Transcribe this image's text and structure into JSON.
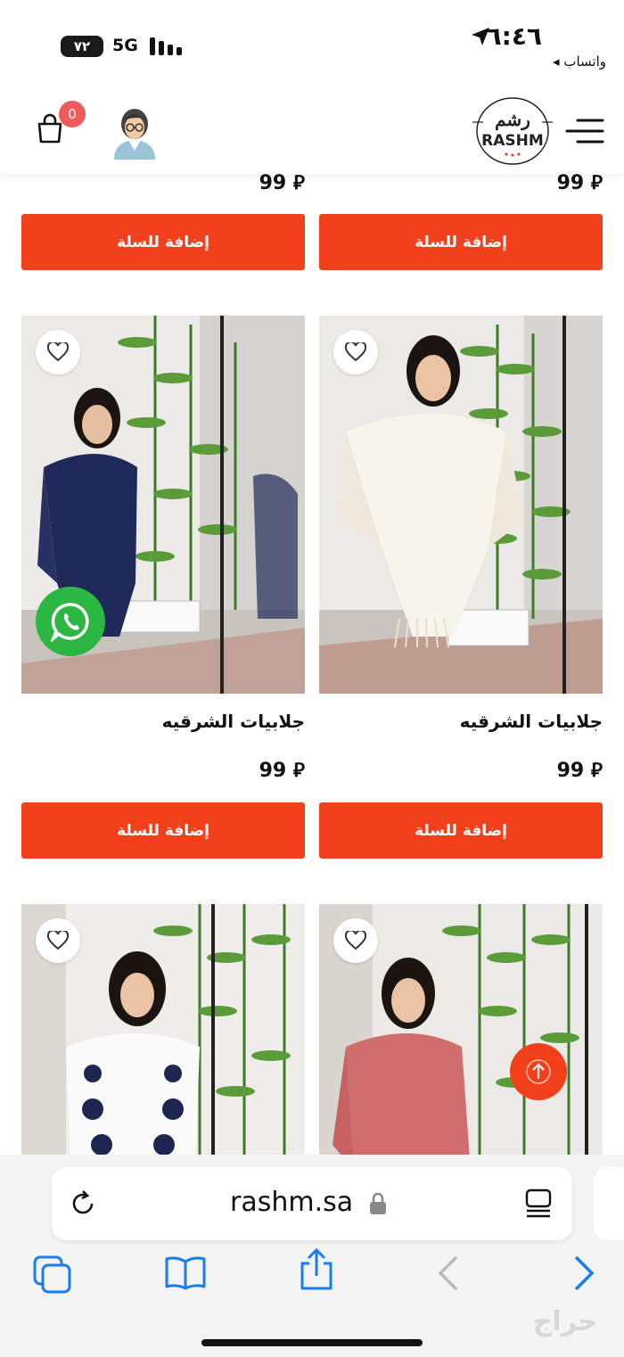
{
  "status_bar": {
    "time": "٦:٤٦",
    "back_app": "◂ واتساب",
    "battery": "٧٢",
    "network": "5G"
  },
  "header": {
    "cart_count": "0",
    "logo_text": "RASHM",
    "logo_arabic": "رشم"
  },
  "products": [
    {
      "price": "99",
      "button": "إضافة للسلة"
    },
    {
      "price": "99",
      "button": "إضافة للسلة"
    },
    {
      "title": "جلابيات الشرقيه",
      "price": "99",
      "button": "إضافة للسلة",
      "image": "woman-white-fringe-kaftan"
    },
    {
      "title": "جلابيات الشرقيه",
      "price": "99",
      "button": "إضافة للسلة",
      "image": "woman-navy-kaftan"
    },
    {
      "image": "woman-pink-fringe-kaftan"
    },
    {
      "image": "woman-black-white-patterned-kaftan"
    }
  ],
  "browser": {
    "url": "rashm.sa"
  },
  "watermark": "حراج",
  "colors": {
    "accent": "#f3401c",
    "whatsapp": "#2bb741",
    "badge": "#f25a5a",
    "ios_blue": "#1a7cf5"
  },
  "icons": [
    "location-arrow-icon",
    "signal-icon",
    "cart-icon",
    "avatar-icon",
    "menu-icon",
    "heart-icon",
    "whatsapp-icon",
    "arrow-up-icon",
    "reload-icon",
    "lock-icon",
    "reader-icon",
    "tabs-icon",
    "bookmarks-icon",
    "share-icon",
    "back-icon",
    "forward-icon"
  ]
}
